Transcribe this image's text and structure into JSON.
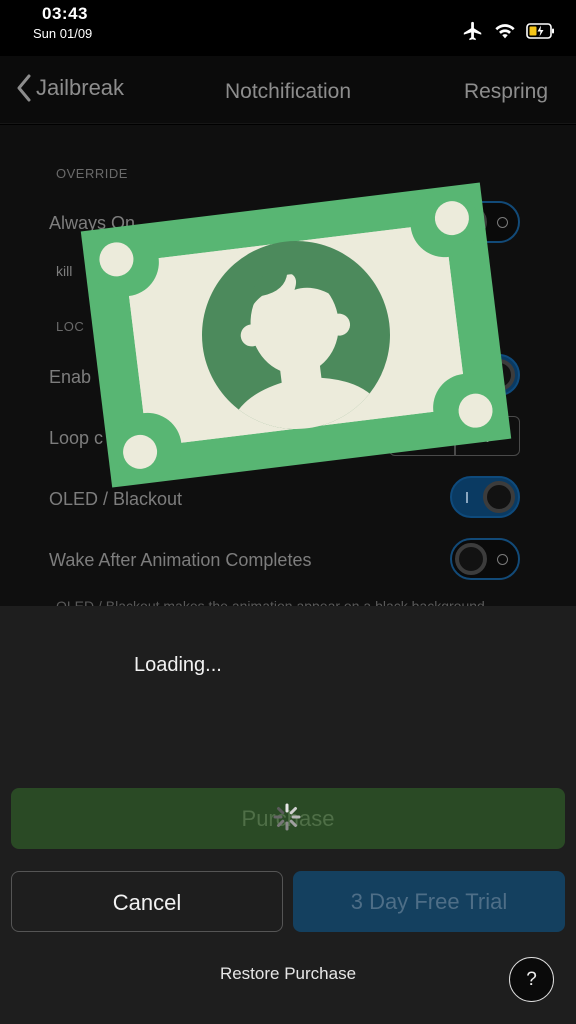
{
  "status": {
    "time": "03:43",
    "date": "Sun 01/09",
    "icons": [
      "airplane-icon",
      "wifi-icon",
      "battery-charging-icon"
    ],
    "battery_color": "#f5c518"
  },
  "nav": {
    "back_label": "Jailbreak",
    "title": "Notchification",
    "right_label": "Respring"
  },
  "settings": {
    "override_header": "OVERRIDE",
    "always_on_label": "Always On",
    "kill_label": "kill",
    "lock_header": "LOC",
    "enable_label": "Enab",
    "loop_label": "Loop c",
    "oled_label": "OLED / Blackout",
    "wake_label": "Wake After Animation Completes",
    "footer": "OLED / Blackout makes the animation appear on a black background",
    "stepper_plus": "+"
  },
  "sheet": {
    "loading": "Loading...",
    "purchase_label": "Purchase",
    "cancel_label": "Cancel",
    "trial_label": "3 Day Free Trial",
    "restore_label": "Restore Purchase",
    "help_label": "?"
  },
  "colors": {
    "money_green": "#58b673",
    "money_paper": "#ecebdb",
    "money_portrait": "#4c8a5c",
    "toggle_blue": "#0a3a62",
    "purchase_green": "#2a4a25",
    "trial_blue": "#14405f"
  }
}
